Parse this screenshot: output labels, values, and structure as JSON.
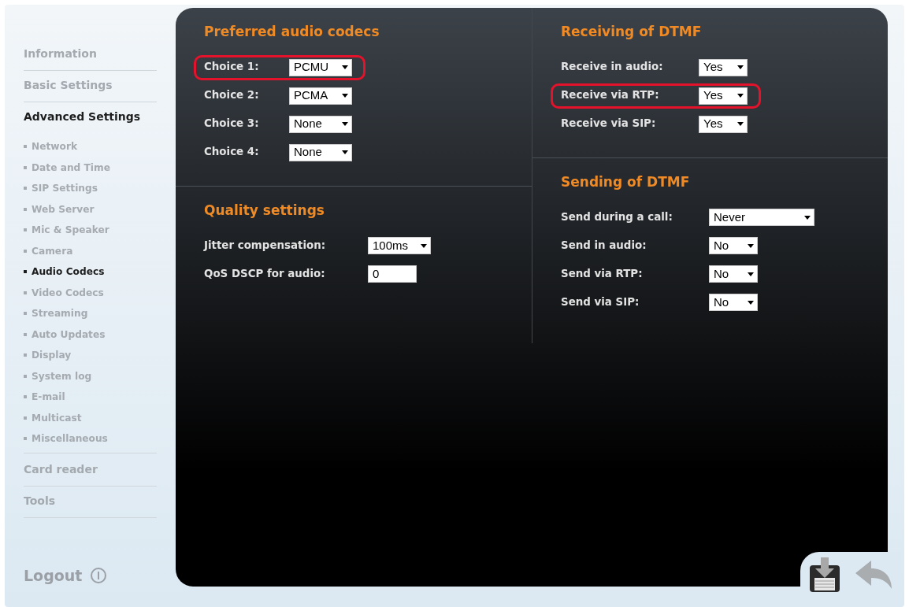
{
  "sidebar": {
    "items": [
      {
        "label": "Information",
        "selected": false
      },
      {
        "label": "Basic Settings",
        "selected": false
      },
      {
        "label": "Advanced Settings",
        "selected": true,
        "children": [
          {
            "label": "Network",
            "selected": false
          },
          {
            "label": "Date and Time",
            "selected": false
          },
          {
            "label": "SIP Settings",
            "selected": false
          },
          {
            "label": "Web Server",
            "selected": false
          },
          {
            "label": "Mic & Speaker",
            "selected": false
          },
          {
            "label": "Camera",
            "selected": false
          },
          {
            "label": "Audio Codecs",
            "selected": true
          },
          {
            "label": "Video Codecs",
            "selected": false
          },
          {
            "label": "Streaming",
            "selected": false
          },
          {
            "label": "Auto Updates",
            "selected": false
          },
          {
            "label": "Display",
            "selected": false
          },
          {
            "label": "System log",
            "selected": false
          },
          {
            "label": "E-mail",
            "selected": false
          },
          {
            "label": "Multicast",
            "selected": false
          },
          {
            "label": "Miscellaneous",
            "selected": false
          }
        ]
      },
      {
        "label": "Card reader",
        "selected": false
      },
      {
        "label": "Tools",
        "selected": false
      }
    ],
    "logout": "Logout"
  },
  "columns": [
    [
      {
        "title": "Preferred audio codecs",
        "fields": [
          {
            "label": "Choice 1:",
            "kind": "select",
            "value": "PCMU",
            "highlighted": true
          },
          {
            "label": "Choice 2:",
            "kind": "select",
            "value": "PCMA",
            "highlighted": false
          },
          {
            "label": "Choice 3:",
            "kind": "select",
            "value": "None",
            "highlighted": false
          },
          {
            "label": "Choice 4:",
            "kind": "select",
            "value": "None",
            "highlighted": false
          }
        ]
      },
      {
        "title": "Quality settings",
        "fields": [
          {
            "label": "Jitter compensation:",
            "kind": "select",
            "value": "100ms",
            "highlighted": false
          },
          {
            "label": "QoS DSCP for audio:",
            "kind": "text",
            "value": "0",
            "highlighted": false
          }
        ]
      }
    ],
    [
      {
        "title": "Receiving of DTMF",
        "fields": [
          {
            "label": "Receive in audio:",
            "kind": "select",
            "value": "Yes",
            "highlighted": false
          },
          {
            "label": "Receive via RTP:",
            "kind": "select",
            "value": "Yes",
            "highlighted": true
          },
          {
            "label": "Receive via SIP:",
            "kind": "select",
            "value": "Yes",
            "highlighted": false
          }
        ]
      },
      {
        "title": "Sending of DTMF",
        "fields": [
          {
            "label": "Send during a call:",
            "kind": "wideselect",
            "value": "Never",
            "highlighted": false
          },
          {
            "label": "Send in audio:",
            "kind": "select",
            "value": "No",
            "highlighted": false
          },
          {
            "label": "Send via RTP:",
            "kind": "select",
            "value": "No",
            "highlighted": false
          },
          {
            "label": "Send via SIP:",
            "kind": "select",
            "value": "No",
            "highlighted": false
          }
        ]
      }
    ]
  ]
}
